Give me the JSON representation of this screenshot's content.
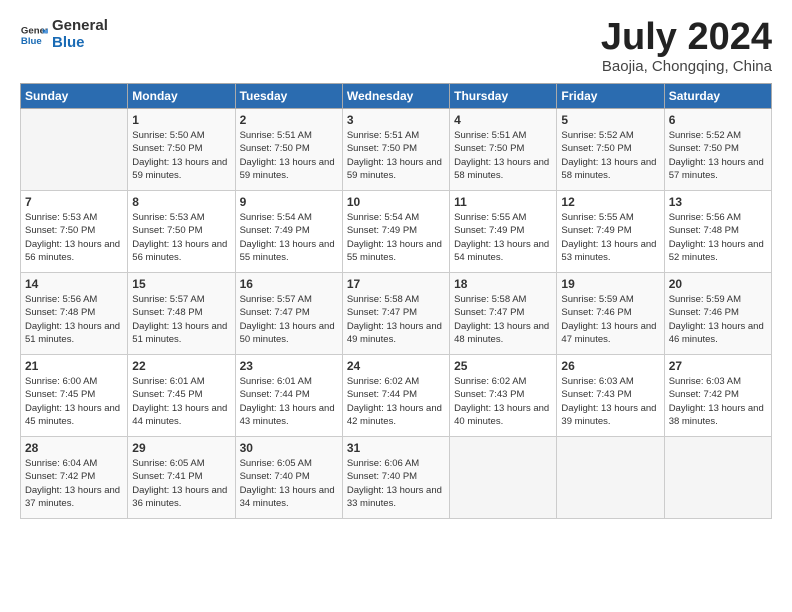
{
  "logo": {
    "line1": "General",
    "line2": "Blue"
  },
  "title": "July 2024",
  "subtitle": "Baojia, Chongqing, China",
  "days_of_week": [
    "Sunday",
    "Monday",
    "Tuesday",
    "Wednesday",
    "Thursday",
    "Friday",
    "Saturday"
  ],
  "weeks": [
    [
      {
        "day": "",
        "sunrise": "",
        "sunset": "",
        "daylight": ""
      },
      {
        "day": "1",
        "sunrise": "Sunrise: 5:50 AM",
        "sunset": "Sunset: 7:50 PM",
        "daylight": "Daylight: 13 hours and 59 minutes."
      },
      {
        "day": "2",
        "sunrise": "Sunrise: 5:51 AM",
        "sunset": "Sunset: 7:50 PM",
        "daylight": "Daylight: 13 hours and 59 minutes."
      },
      {
        "day": "3",
        "sunrise": "Sunrise: 5:51 AM",
        "sunset": "Sunset: 7:50 PM",
        "daylight": "Daylight: 13 hours and 59 minutes."
      },
      {
        "day": "4",
        "sunrise": "Sunrise: 5:51 AM",
        "sunset": "Sunset: 7:50 PM",
        "daylight": "Daylight: 13 hours and 58 minutes."
      },
      {
        "day": "5",
        "sunrise": "Sunrise: 5:52 AM",
        "sunset": "Sunset: 7:50 PM",
        "daylight": "Daylight: 13 hours and 58 minutes."
      },
      {
        "day": "6",
        "sunrise": "Sunrise: 5:52 AM",
        "sunset": "Sunset: 7:50 PM",
        "daylight": "Daylight: 13 hours and 57 minutes."
      }
    ],
    [
      {
        "day": "7",
        "sunrise": "Sunrise: 5:53 AM",
        "sunset": "Sunset: 7:50 PM",
        "daylight": "Daylight: 13 hours and 56 minutes."
      },
      {
        "day": "8",
        "sunrise": "Sunrise: 5:53 AM",
        "sunset": "Sunset: 7:50 PM",
        "daylight": "Daylight: 13 hours and 56 minutes."
      },
      {
        "day": "9",
        "sunrise": "Sunrise: 5:54 AM",
        "sunset": "Sunset: 7:49 PM",
        "daylight": "Daylight: 13 hours and 55 minutes."
      },
      {
        "day": "10",
        "sunrise": "Sunrise: 5:54 AM",
        "sunset": "Sunset: 7:49 PM",
        "daylight": "Daylight: 13 hours and 55 minutes."
      },
      {
        "day": "11",
        "sunrise": "Sunrise: 5:55 AM",
        "sunset": "Sunset: 7:49 PM",
        "daylight": "Daylight: 13 hours and 54 minutes."
      },
      {
        "day": "12",
        "sunrise": "Sunrise: 5:55 AM",
        "sunset": "Sunset: 7:49 PM",
        "daylight": "Daylight: 13 hours and 53 minutes."
      },
      {
        "day": "13",
        "sunrise": "Sunrise: 5:56 AM",
        "sunset": "Sunset: 7:48 PM",
        "daylight": "Daylight: 13 hours and 52 minutes."
      }
    ],
    [
      {
        "day": "14",
        "sunrise": "Sunrise: 5:56 AM",
        "sunset": "Sunset: 7:48 PM",
        "daylight": "Daylight: 13 hours and 51 minutes."
      },
      {
        "day": "15",
        "sunrise": "Sunrise: 5:57 AM",
        "sunset": "Sunset: 7:48 PM",
        "daylight": "Daylight: 13 hours and 51 minutes."
      },
      {
        "day": "16",
        "sunrise": "Sunrise: 5:57 AM",
        "sunset": "Sunset: 7:47 PM",
        "daylight": "Daylight: 13 hours and 50 minutes."
      },
      {
        "day": "17",
        "sunrise": "Sunrise: 5:58 AM",
        "sunset": "Sunset: 7:47 PM",
        "daylight": "Daylight: 13 hours and 49 minutes."
      },
      {
        "day": "18",
        "sunrise": "Sunrise: 5:58 AM",
        "sunset": "Sunset: 7:47 PM",
        "daylight": "Daylight: 13 hours and 48 minutes."
      },
      {
        "day": "19",
        "sunrise": "Sunrise: 5:59 AM",
        "sunset": "Sunset: 7:46 PM",
        "daylight": "Daylight: 13 hours and 47 minutes."
      },
      {
        "day": "20",
        "sunrise": "Sunrise: 5:59 AM",
        "sunset": "Sunset: 7:46 PM",
        "daylight": "Daylight: 13 hours and 46 minutes."
      }
    ],
    [
      {
        "day": "21",
        "sunrise": "Sunrise: 6:00 AM",
        "sunset": "Sunset: 7:45 PM",
        "daylight": "Daylight: 13 hours and 45 minutes."
      },
      {
        "day": "22",
        "sunrise": "Sunrise: 6:01 AM",
        "sunset": "Sunset: 7:45 PM",
        "daylight": "Daylight: 13 hours and 44 minutes."
      },
      {
        "day": "23",
        "sunrise": "Sunrise: 6:01 AM",
        "sunset": "Sunset: 7:44 PM",
        "daylight": "Daylight: 13 hours and 43 minutes."
      },
      {
        "day": "24",
        "sunrise": "Sunrise: 6:02 AM",
        "sunset": "Sunset: 7:44 PM",
        "daylight": "Daylight: 13 hours and 42 minutes."
      },
      {
        "day": "25",
        "sunrise": "Sunrise: 6:02 AM",
        "sunset": "Sunset: 7:43 PM",
        "daylight": "Daylight: 13 hours and 40 minutes."
      },
      {
        "day": "26",
        "sunrise": "Sunrise: 6:03 AM",
        "sunset": "Sunset: 7:43 PM",
        "daylight": "Daylight: 13 hours and 39 minutes."
      },
      {
        "day": "27",
        "sunrise": "Sunrise: 6:03 AM",
        "sunset": "Sunset: 7:42 PM",
        "daylight": "Daylight: 13 hours and 38 minutes."
      }
    ],
    [
      {
        "day": "28",
        "sunrise": "Sunrise: 6:04 AM",
        "sunset": "Sunset: 7:42 PM",
        "daylight": "Daylight: 13 hours and 37 minutes."
      },
      {
        "day": "29",
        "sunrise": "Sunrise: 6:05 AM",
        "sunset": "Sunset: 7:41 PM",
        "daylight": "Daylight: 13 hours and 36 minutes."
      },
      {
        "day": "30",
        "sunrise": "Sunrise: 6:05 AM",
        "sunset": "Sunset: 7:40 PM",
        "daylight": "Daylight: 13 hours and 34 minutes."
      },
      {
        "day": "31",
        "sunrise": "Sunrise: 6:06 AM",
        "sunset": "Sunset: 7:40 PM",
        "daylight": "Daylight: 13 hours and 33 minutes."
      },
      {
        "day": "",
        "sunrise": "",
        "sunset": "",
        "daylight": ""
      },
      {
        "day": "",
        "sunrise": "",
        "sunset": "",
        "daylight": ""
      },
      {
        "day": "",
        "sunrise": "",
        "sunset": "",
        "daylight": ""
      }
    ]
  ]
}
